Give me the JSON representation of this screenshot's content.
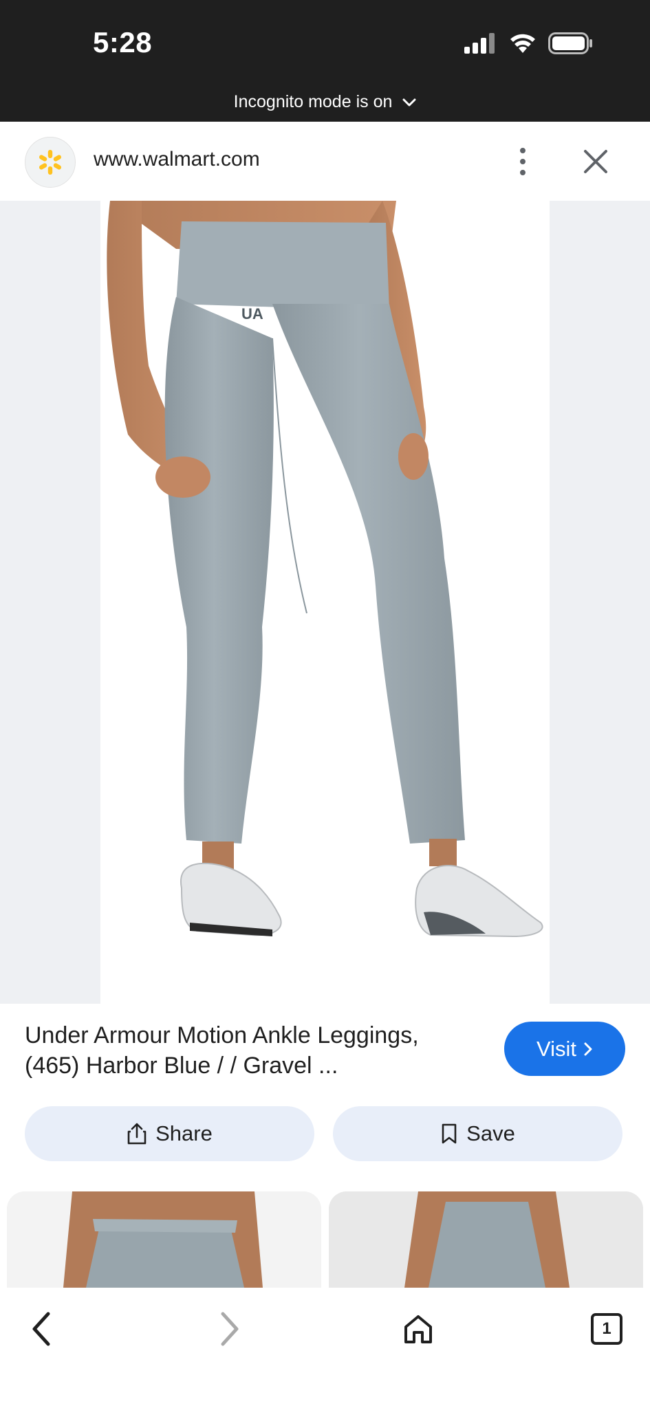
{
  "status_bar": {
    "time": "5:28",
    "signal_icon": "cellular-signal-icon",
    "wifi_icon": "wifi-icon",
    "battery_icon": "battery-icon"
  },
  "incognito": {
    "label": "Incognito mode is on",
    "icon": "chevron-down-icon"
  },
  "url_bar": {
    "favicon": "walmart-spark-icon",
    "url": "www.walmart.com",
    "menu_icon": "more-vertical-icon",
    "close_icon": "close-icon"
  },
  "product": {
    "title": "Under Armour Motion Ankle Leggings, (465) Harbor Blue / / Gravel ...",
    "visit_label": "Visit",
    "share_label": "Share",
    "save_label": "Save"
  },
  "bottom_nav": {
    "back_icon": "back-arrow-icon",
    "forward_icon": "forward-arrow-icon",
    "home_icon": "home-icon",
    "tab_count": "1"
  },
  "colors": {
    "status_bar_bg": "#1f1f1f",
    "accent_blue": "#1a73e8",
    "pill_bg": "#e8eef9",
    "legging_gray": "#98a5ac"
  }
}
